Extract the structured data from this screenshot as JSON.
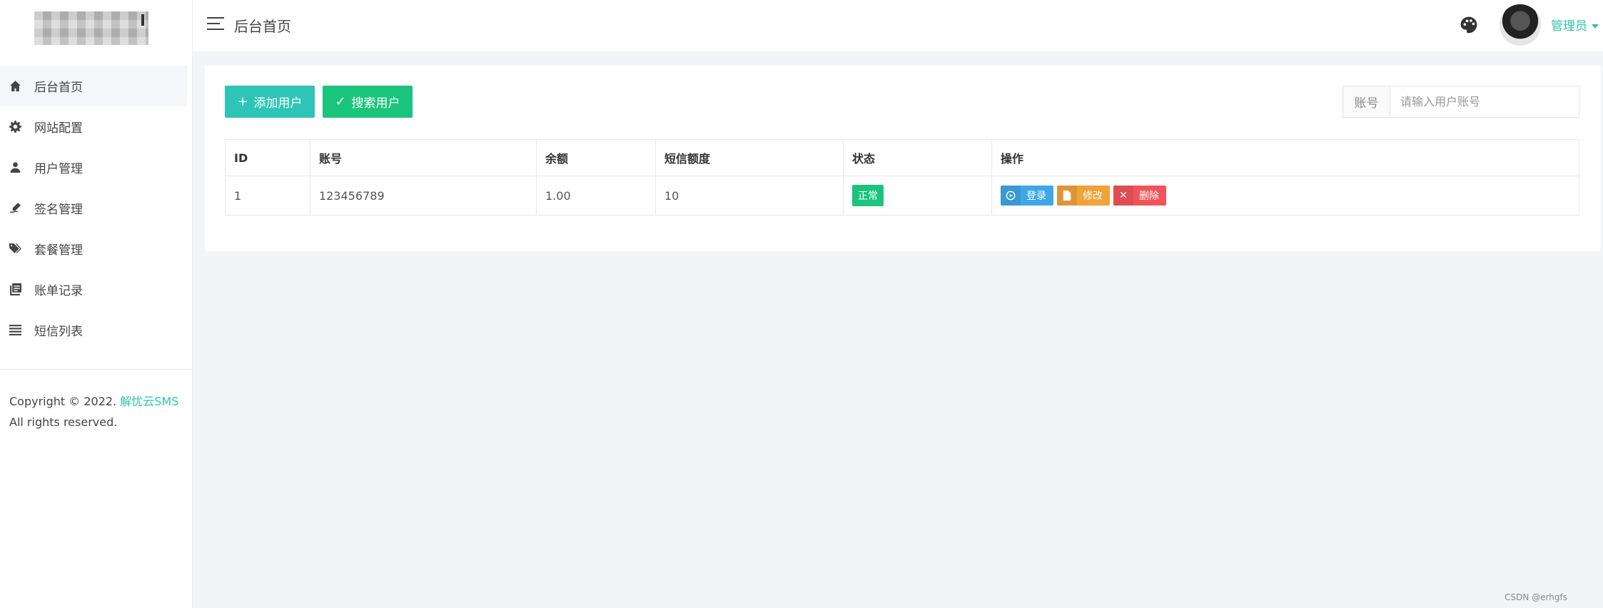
{
  "sidebar": {
    "items": [
      {
        "label": "后台首页",
        "icon": "home-icon"
      },
      {
        "label": "网站配置",
        "icon": "gear-icon"
      },
      {
        "label": "用户管理",
        "icon": "user-icon"
      },
      {
        "label": "签名管理",
        "icon": "signature-icon"
      },
      {
        "label": "套餐管理",
        "icon": "tags-icon"
      },
      {
        "label": "账单记录",
        "icon": "ledger-icon"
      },
      {
        "label": "短信列表",
        "icon": "list-icon"
      }
    ],
    "copyright_prefix": "Copyright © 2022. ",
    "copyright_brand": "解忧云SMS",
    "copyright_suffix": "All rights reserved."
  },
  "header": {
    "title": "后台首页",
    "user": "管理员"
  },
  "toolbar": {
    "add_label": "添加用户",
    "search_label": "搜索用户",
    "account_label": "账号",
    "account_placeholder": "请输入用户账号"
  },
  "table": {
    "headers": [
      "ID",
      "账号",
      "余额",
      "短信额度",
      "状态",
      "操作"
    ],
    "rows": [
      {
        "id": "1",
        "account": "123456789",
        "balance": "1.00",
        "quota": "10",
        "status": "正常"
      }
    ],
    "actions": {
      "login": "登录",
      "edit": "修改",
      "delete": "删除"
    }
  },
  "watermark": "CSDN @erhgfs",
  "colors": {
    "accent": "#2ec4ad",
    "success": "#1bc47d",
    "info": "#3fa7e6",
    "warning": "#f0a23b",
    "danger": "#f0545a"
  }
}
